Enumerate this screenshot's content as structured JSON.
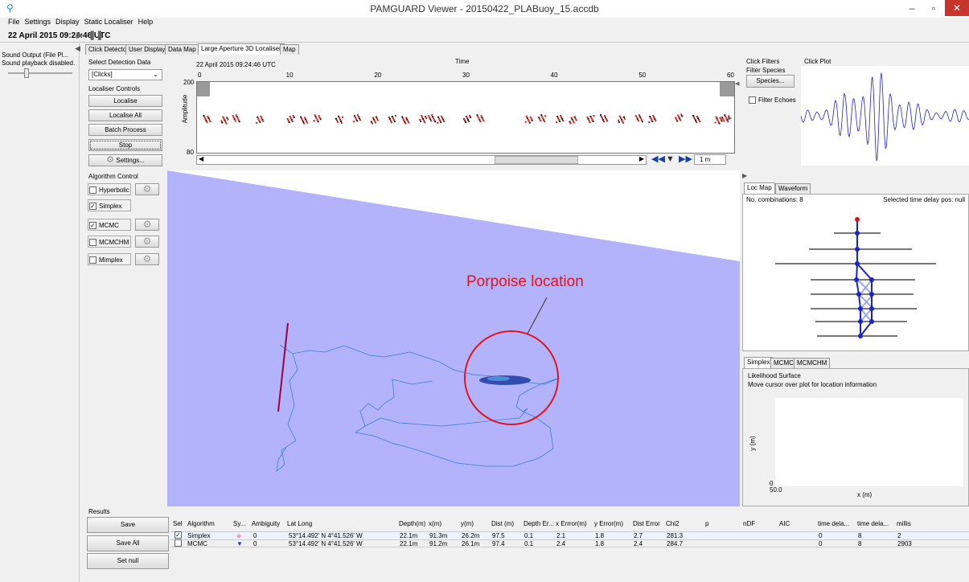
{
  "window": {
    "title": "PAMGUARD Viewer - 20150422_PLABuoy_15.accdb",
    "minimize": "–",
    "restore": "▫",
    "close": "✕"
  },
  "menu": [
    "File",
    "Settings",
    "Display",
    "Static Localiser",
    "Help"
  ],
  "timebar": {
    "time": "22 April 2015 09:24:46 UTC"
  },
  "sound": {
    "title": "Sound Output (File Pl...",
    "status": "Sound playback disabled."
  },
  "tabs": [
    "Click Detector",
    "User Display",
    "Data Map",
    "Large Aperture 3D Localiser",
    "Map"
  ],
  "active_tab": 3,
  "controls": {
    "select_label": "Select Detection Data",
    "select_value": "[Clicks]",
    "localiser_label": "Localiser Controls",
    "buttons": [
      "Localise",
      "Localise All",
      "Batch Process",
      "Stop"
    ],
    "settings": "Settings...",
    "algorithm_label": "Algorithm Control",
    "algorithms": [
      {
        "name": "Hyperbolic",
        "checked": false,
        "gear": true
      },
      {
        "name": "Simplex",
        "checked": true,
        "gear": false
      },
      {
        "name": "MCMC",
        "checked": true,
        "gear": true
      },
      {
        "name": "MCMCHM",
        "checked": false,
        "gear": true
      },
      {
        "name": "Mimplex",
        "checked": false,
        "gear": true
      }
    ]
  },
  "scope": {
    "time_stamp": "22 April 2015 09:24:46 UTC",
    "axis_title": "Time",
    "ylabel": "Amplitude",
    "y_top": "200",
    "y_bottom": "80",
    "ticks": [
      "0",
      "10",
      "20",
      "30",
      "40",
      "50",
      "60"
    ],
    "span": "1 m"
  },
  "chart_data": {
    "type": "scatter",
    "title": "",
    "xlabel": "Time",
    "ylabel": "Amplitude",
    "xlim": [
      0,
      60
    ],
    "ylim": [
      80,
      200
    ],
    "x": [
      0.5,
      2.5,
      3.8,
      6.5,
      10,
      11.5,
      13,
      15.5,
      17.5,
      19.5,
      21.5,
      23,
      25,
      26,
      27,
      30,
      31.5,
      37,
      38.5,
      40.5,
      42,
      44,
      45.5,
      47.5,
      49.5,
      51,
      54,
      56,
      58.5,
      59.3
    ],
    "y": [
      140,
      138,
      141,
      139,
      140,
      138,
      141,
      139,
      141,
      138,
      140,
      138,
      140,
      141,
      139,
      140,
      141,
      139,
      141,
      140,
      138,
      140,
      141,
      139,
      141,
      140,
      142,
      140,
      138,
      141
    ],
    "grid": false
  },
  "click_filters": {
    "title": "Click Filters",
    "species_label": "Filter Species",
    "species_button": "Species...",
    "echo_label": "Filter Echoes"
  },
  "click_plot": {
    "title": "Click Plot"
  },
  "loc_map": {
    "tabs": [
      "Loc Map",
      "Waveform"
    ],
    "combinations": "No. combinations: 8",
    "selected": "Selected time delay pos: null"
  },
  "likelihood": {
    "tabs": [
      "Simplex",
      "MCMC",
      "MCMCHM"
    ],
    "group_label": "Likelihood Surface",
    "hint": "Move cursor over plot for location information",
    "ylabel": "y (m)",
    "xlabel": "x (m)",
    "y0": "0",
    "x0": "50.0"
  },
  "annotation": {
    "text": "Porpoise location"
  },
  "results": {
    "label": "Results",
    "buttons": [
      "Save",
      "Save All",
      "Set null"
    ],
    "headers": [
      "Sel",
      "Algorithm",
      "Sy...",
      "Ambiguity",
      "Lat Long",
      "Depth(m)",
      "x(m)",
      "y(m)",
      "Dist (m)",
      "Depth Er...",
      "x Errror(m)",
      "y Error(m)",
      "Dist Error",
      "Chi2",
      "p",
      "nDF",
      "AIC",
      "time dela...",
      "time dela...",
      "millis"
    ],
    "rows": [
      {
        "sel": true,
        "algorithm": "Simplex",
        "symbol": "◆",
        "ambiguity": "0",
        "latlong": "53°14.492' N   4°41.526' W",
        "depth": "22.1m",
        "x": "91.3m",
        "y": "26.2m",
        "dist": "97.5",
        "depth_err": "0.1",
        "x_err": "2.1",
        "y_err": "1.8",
        "dist_err": "2.7",
        "chi2": "281.3",
        "p": "",
        "ndf": "",
        "aic": "",
        "td1": "0",
        "td2": "8",
        "millis": "2"
      },
      {
        "sel": false,
        "algorithm": "MCMC",
        "symbol": "▼",
        "ambiguity": "0",
        "latlong": "53°14.492' N   4°41.526' W",
        "depth": "22.1m",
        "x": "91.2m",
        "y": "26.1m",
        "dist": "97.4",
        "depth_err": "0.1",
        "x_err": "2.4",
        "y_err": "1.8",
        "dist_err": "2.4",
        "chi2": "284.7",
        "p": "",
        "ndf": "",
        "aic": "",
        "td1": "0",
        "td2": "8",
        "millis": "2903"
      }
    ]
  },
  "colors": {
    "map_water": "#b3b3fb",
    "track": "#3b7fd8",
    "annotation": "#e0141e",
    "close": "#c7342b",
    "detections": "#e01010"
  }
}
